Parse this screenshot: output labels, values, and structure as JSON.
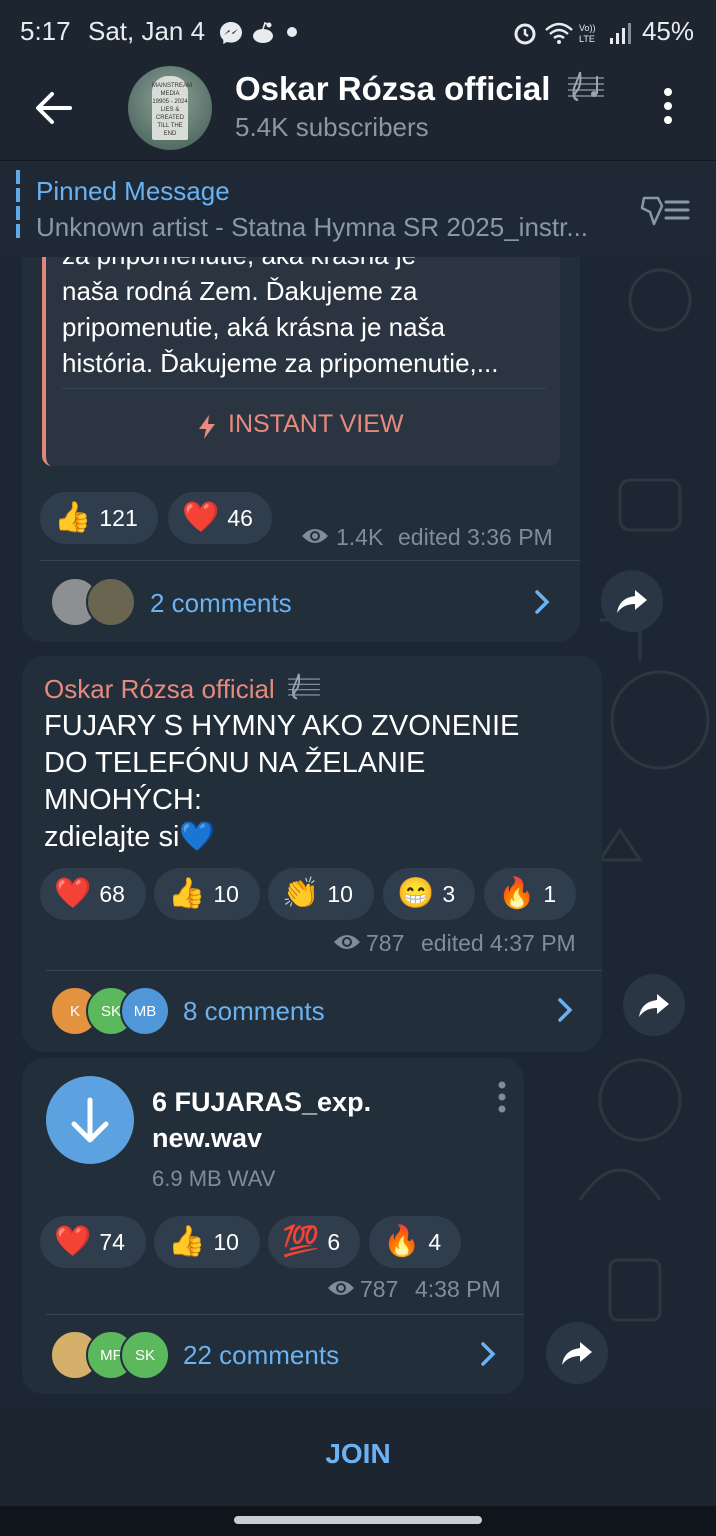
{
  "status_bar": {
    "time": "5:17",
    "date": "Sat, Jan 4",
    "battery": "45%"
  },
  "header": {
    "channel_name": "Oskar Rózsa official",
    "title_icon": "music-score-icon",
    "subscribers": "5.4K subscribers",
    "avatar_text": "MAINSTREAM MEDIA 19905 - 2024 LIES & CREATED TILL THE END"
  },
  "pinned": {
    "title": "Pinned Message",
    "text": "Unknown artist - Statna Hymna SR 2025_instr..."
  },
  "post1": {
    "article_lines": [
      "za pripomenutie, aká krásna je",
      "naša rodná Zem. Ďakujeme za",
      "pripomenutie, aká krásna je naša",
      "história. Ďakujeme za pripomenutie,..."
    ],
    "instant_view": "INSTANT VIEW",
    "reactions": [
      {
        "emoji": "👍",
        "count": "121"
      },
      {
        "emoji": "❤️",
        "count": "46"
      }
    ],
    "views": "1.4K",
    "time": "edited 3:36 PM",
    "comments": "2 comments"
  },
  "post2": {
    "author": "Oskar Rózsa official",
    "text_lines": [
      "FUJARY S HYMNY AKO ZVONENIE",
      "DO TELEFÓNU NA ŽELANIE",
      "MNOHÝCH:",
      "zdielajte si💙"
    ],
    "reactions": [
      {
        "emoji": "❤️",
        "count": "68"
      },
      {
        "emoji": "👍",
        "count": "10"
      },
      {
        "emoji": "👏",
        "count": "10"
      },
      {
        "emoji": "😁",
        "count": "3"
      },
      {
        "emoji": "🔥",
        "count": "1"
      }
    ],
    "views": "787",
    "time": "edited 4:37 PM",
    "comment_avatars": [
      "K",
      "SK",
      "MB"
    ],
    "comments": "8 comments"
  },
  "post3": {
    "file_name": "6 FUJARAS_exp.\nnew.wav",
    "file_name_lines": [
      "6 FUJARAS_exp.",
      "new.wav"
    ],
    "file_size": "6.9 MB WAV",
    "reactions": [
      {
        "emoji": "❤️",
        "count": "74"
      },
      {
        "emoji": "👍",
        "count": "10"
      },
      {
        "emoji": "💯",
        "count": "6"
      },
      {
        "emoji": "🔥",
        "count": "4"
      }
    ],
    "views": "787",
    "time": "4:38 PM",
    "comment_avatars": [
      "",
      "MF",
      "SK"
    ],
    "comments": "22 comments"
  },
  "footer": {
    "join_label": "JOIN"
  },
  "colors": {
    "background": "#1d2733",
    "bubble": "#222e3a",
    "accent_blue": "#6ab2f2",
    "author_color": "#e8897d"
  }
}
